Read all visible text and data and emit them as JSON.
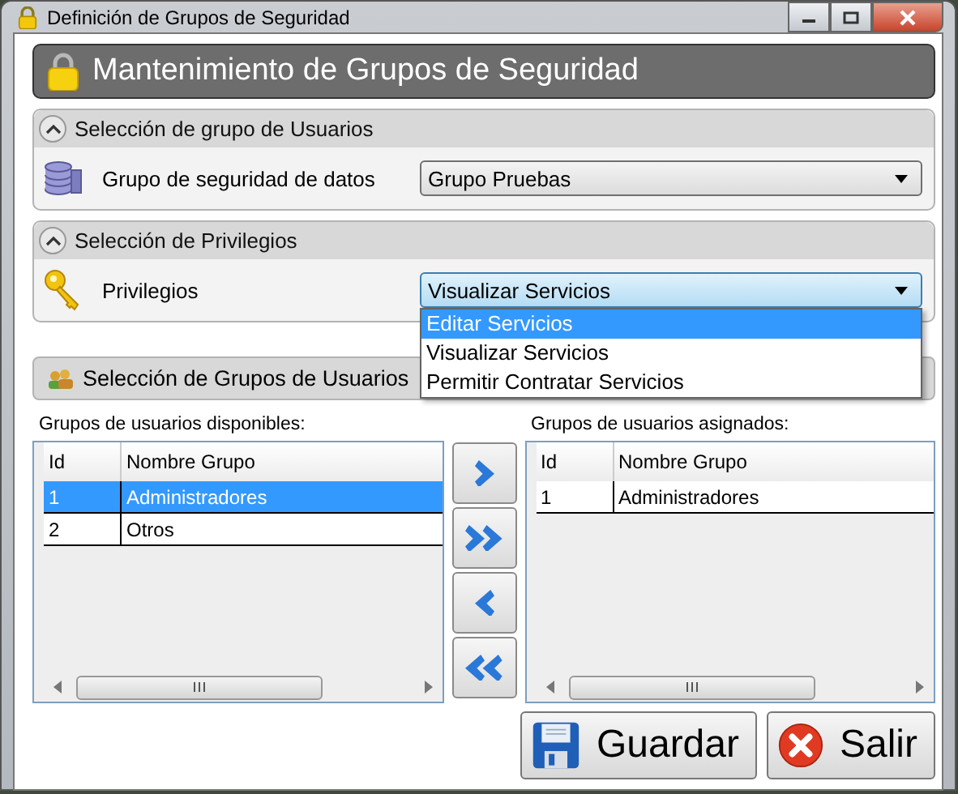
{
  "window": {
    "title": "Definición de Grupos de Seguridad"
  },
  "header": {
    "title": "Mantenimiento de Grupos de Seguridad"
  },
  "sections": [
    {
      "title": "Selección de grupo de Usuarios",
      "expanded": true,
      "kind": "database",
      "field": {
        "label": "Grupo de seguridad de datos",
        "value": "Grupo Pruebas",
        "open": false
      }
    },
    {
      "title": "Selección de Privilegios",
      "expanded": true,
      "kind": "key",
      "field": {
        "label": "Privilegios",
        "value": "Visualizar Servicios",
        "open": true,
        "options": [
          {
            "label": "Editar Servicios",
            "highlighted": true
          },
          {
            "label": "Visualizar Servicios",
            "highlighted": false
          },
          {
            "label": "Permitir Contratar Servicios",
            "highlighted": false
          }
        ]
      }
    }
  ],
  "groups_section": {
    "title": "Selección de Grupos de Usuarios"
  },
  "grids": [
    {
      "label": "Grupos de usuarios disponibles:",
      "columns": [
        "Id",
        "Nombre Grupo"
      ],
      "rows": [
        {
          "cells": [
            "1",
            "Administradores"
          ],
          "selected": true
        },
        {
          "cells": [
            "2",
            "Otros"
          ],
          "selected": false
        }
      ]
    },
    {
      "label": "Grupos de usuarios asignados:",
      "columns": [
        "Id",
        "Nombre Grupo"
      ],
      "rows": [
        {
          "cells": [
            "1",
            "Administradores"
          ],
          "selected": false
        }
      ]
    }
  ],
  "move_buttons": [
    {
      "kind": "right"
    },
    {
      "kind": "all_right"
    },
    {
      "kind": "left"
    },
    {
      "kind": "all_left"
    }
  ],
  "buttons": [
    {
      "label": "Guardar",
      "kind": "save"
    },
    {
      "label": "Salir",
      "kind": "exit"
    }
  ]
}
